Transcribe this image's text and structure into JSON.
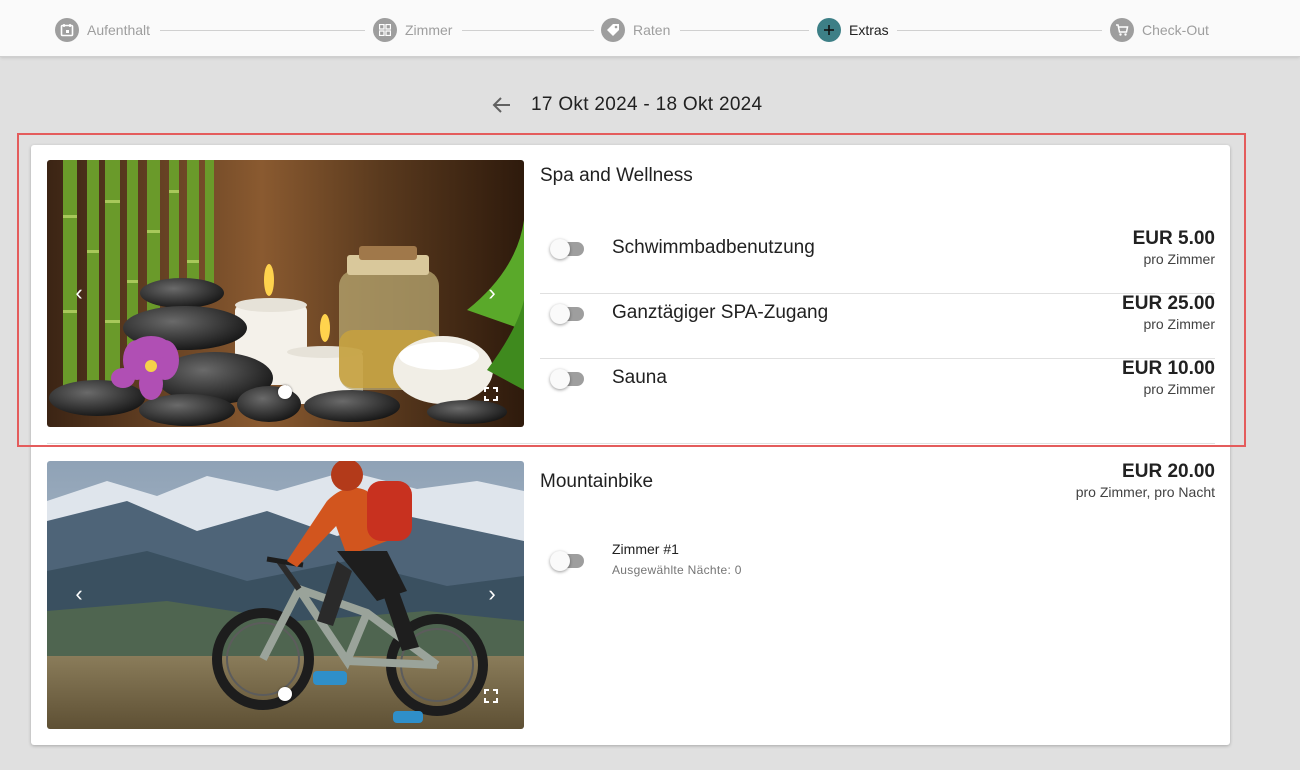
{
  "stepper": {
    "steps": [
      {
        "label": "Aufenthalt",
        "icon": "calendar-icon"
      },
      {
        "label": "Zimmer",
        "icon": "grid-icon"
      },
      {
        "label": "Raten",
        "icon": "tag-icon"
      },
      {
        "label": "Extras",
        "icon": "plus-icon",
        "active": true
      },
      {
        "label": "Check-Out",
        "icon": "cart-icon"
      }
    ],
    "active_color": "#3d7f86",
    "inactive_color": "#9e9e9e"
  },
  "header": {
    "date_range": "17 Okt 2024 - 18 Okt 2024"
  },
  "spa": {
    "title": "Spa and Wellness",
    "options": [
      {
        "name": "Schwimmbadbenutzung",
        "price": "EUR 5.00",
        "unit": "pro Zimmer",
        "enabled": false
      },
      {
        "name": "Ganztägiger SPA-Zugang",
        "price": "EUR 25.00",
        "unit": "pro Zimmer",
        "enabled": false
      },
      {
        "name": "Sauna",
        "price": "EUR 10.00",
        "unit": "pro Zimmer",
        "enabled": false
      }
    ]
  },
  "bike": {
    "title": "Mountainbike",
    "price": "EUR 20.00",
    "unit": "pro Zimmer, pro Nacht",
    "room_label": "Zimmer #1",
    "room_sub": "Ausgewählte Nächte: 0",
    "enabled": false
  },
  "carousel": {
    "prev_glyph": "‹",
    "next_glyph": "›"
  },
  "highlight_color": "#e45c5c"
}
